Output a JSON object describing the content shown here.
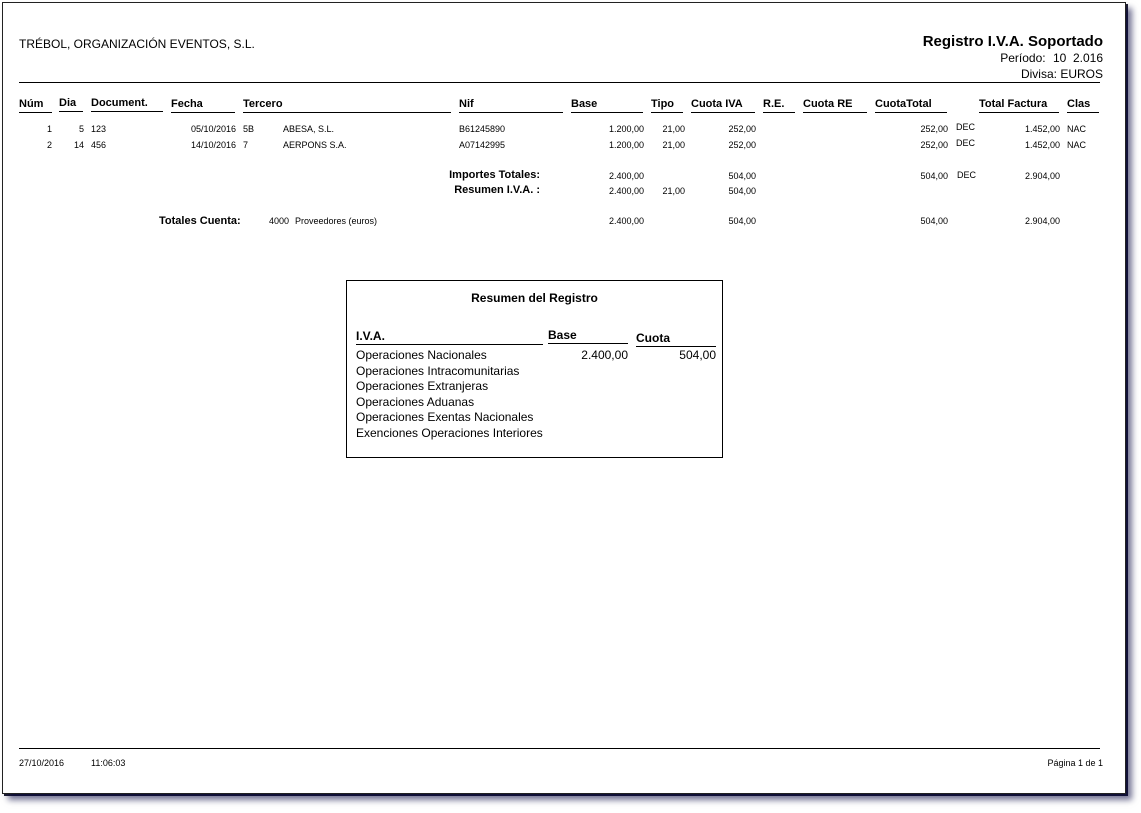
{
  "company": "TRÉBOL, ORGANIZACIÓN EVENTOS, S.L.",
  "report": {
    "title": "Registro I.V.A. Soportado",
    "periodo_label": "Período:",
    "periodo_value": "10  2.016",
    "divisa_label": "Divisa:",
    "divisa_value": "EUROS"
  },
  "columns": [
    "Núm",
    "Dia",
    "Document.",
    "Fecha",
    "Tercero",
    "Nif",
    "Base",
    "Tipo",
    "Cuota IVA",
    "R.E.",
    "Cuota RE",
    "CuotaTotal",
    "Total Factura",
    "Clas"
  ],
  "rows": [
    {
      "num": "1",
      "dia": "5",
      "doc": "123",
      "fecha": "05/10/2016",
      "cod": "5B",
      "tercero": "ABESA, S.L.",
      "nif": "B61245890",
      "base": "1.200,00",
      "tipo": "21,00",
      "cuota_iva": "252,00",
      "cuota_total": "252,00",
      "dec": "DEC",
      "total_factura": "1.452,00",
      "clas": "NAC"
    },
    {
      "num": "2",
      "dia": "14",
      "doc": "456",
      "fecha": "14/10/2016",
      "cod": "7",
      "tercero": "AERPONS S.A.",
      "nif": "A07142995",
      "base": "1.200,00",
      "tipo": "21,00",
      "cuota_iva": "252,00",
      "cuota_total": "252,00",
      "dec": "DEC",
      "total_factura": "1.452,00",
      "clas": "NAC"
    }
  ],
  "importes": {
    "label": "Importes Totales:",
    "base": "2.400,00",
    "cuota_iva": "504,00",
    "cuota_total": "504,00",
    "dec": "DEC",
    "total_factura": "2.904,00"
  },
  "resumen_iva": {
    "label": "Resumen I.V.A. :",
    "base": "2.400,00",
    "tipo": "21,00",
    "cuota_iva": "504,00"
  },
  "totales_cuenta": {
    "label": "Totales Cuenta:",
    "cuenta": "4000",
    "descripcion": "Proveedores (euros)",
    "base": "2.400,00",
    "cuota_iva": "504,00",
    "cuota_total": "504,00",
    "total_factura": "2.904,00"
  },
  "summary": {
    "title": "Resumen del Registro",
    "col_iva": "I.V.A.",
    "col_base": "Base",
    "col_cuota": "Cuota",
    "rows": [
      {
        "label": "Operaciones Nacionales",
        "base": "2.400,00",
        "cuota": "504,00"
      },
      {
        "label": "Operaciones Intracomunitarias"
      },
      {
        "label": "Operaciones Extranjeras"
      },
      {
        "label": "Operaciones Aduanas"
      },
      {
        "label": "Operaciones Exentas Nacionales"
      },
      {
        "label": "Exenciones Operaciones Interiores"
      }
    ]
  },
  "footer": {
    "date": "27/10/2016",
    "time": "11:06:03",
    "page": "Página 1 de 1"
  }
}
